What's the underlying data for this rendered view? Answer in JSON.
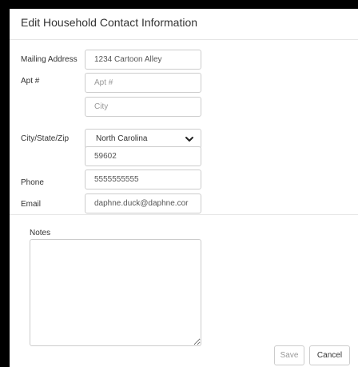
{
  "dialog": {
    "title": "Edit Household Contact Information"
  },
  "form": {
    "mailing_address": {
      "label": "Mailing Address",
      "value": "1234 Cartoon Alley"
    },
    "apt": {
      "label": "Apt #",
      "value": "",
      "placeholder": "Apt #"
    },
    "city": {
      "value": "",
      "placeholder": "City"
    },
    "state": {
      "label": "City/State/Zip",
      "selected": "North Carolina"
    },
    "zip": {
      "value": "59602"
    },
    "phone": {
      "label": "Phone",
      "value": "5555555555"
    },
    "email": {
      "label": "Email",
      "value": "daphne.duck@daphne.cor"
    },
    "notes": {
      "label": "Notes",
      "value": ""
    }
  },
  "footer": {
    "save_label": "Save",
    "cancel_label": "Cancel"
  },
  "icons": {
    "state_dropdown": "chevron-down-icon",
    "notes_resize": "resize-handle-icon"
  }
}
